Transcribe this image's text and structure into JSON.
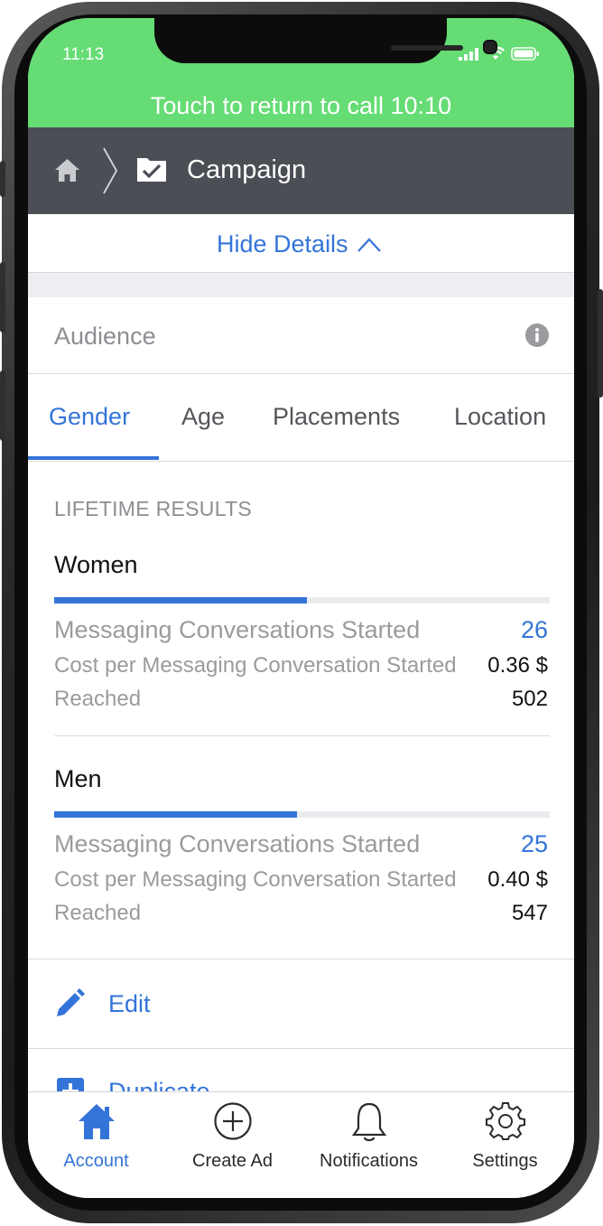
{
  "status_bar": {
    "time": "11:13"
  },
  "call_banner": {
    "message": "Touch to return to call 10:10"
  },
  "nav": {
    "title": "Campaign"
  },
  "details": {
    "hide_label": "Hide Details"
  },
  "audience": {
    "label": "Audience"
  },
  "tabs": [
    {
      "label": "Gender",
      "active": true
    },
    {
      "label": "Age",
      "active": false
    },
    {
      "label": "Placements",
      "active": false
    },
    {
      "label": "Location",
      "active": false
    }
  ],
  "results": {
    "section_label": "LIFETIME RESULTS",
    "groups": [
      {
        "name": "Women",
        "bar_fraction": 0.51,
        "conversations_label": "Messaging Conversations Started",
        "conversations_value": "26",
        "cost_label": "Cost per Messaging Conversation Started",
        "cost_value": "0.36 $",
        "reached_label": "Reached",
        "reached_value": "502"
      },
      {
        "name": "Men",
        "bar_fraction": 0.49,
        "conversations_label": "Messaging Conversations Started",
        "conversations_value": "25",
        "cost_label": "Cost per Messaging Conversation Started",
        "cost_value": "0.40 $",
        "reached_label": "Reached",
        "reached_value": "547"
      }
    ]
  },
  "actions": {
    "edit_label": "Edit",
    "duplicate_label": "Duplicate"
  },
  "tab_bar": [
    {
      "label": "Account",
      "icon": "home-icon",
      "active": true
    },
    {
      "label": "Create Ad",
      "icon": "plus-circle-icon",
      "active": false
    },
    {
      "label": "Notifications",
      "icon": "bell-icon",
      "active": false
    },
    {
      "label": "Settings",
      "icon": "gear-icon",
      "active": false
    }
  ],
  "colors": {
    "accent": "#3474d8",
    "call_banner": "#65dc74",
    "nav_bar": "#4b4e55"
  }
}
